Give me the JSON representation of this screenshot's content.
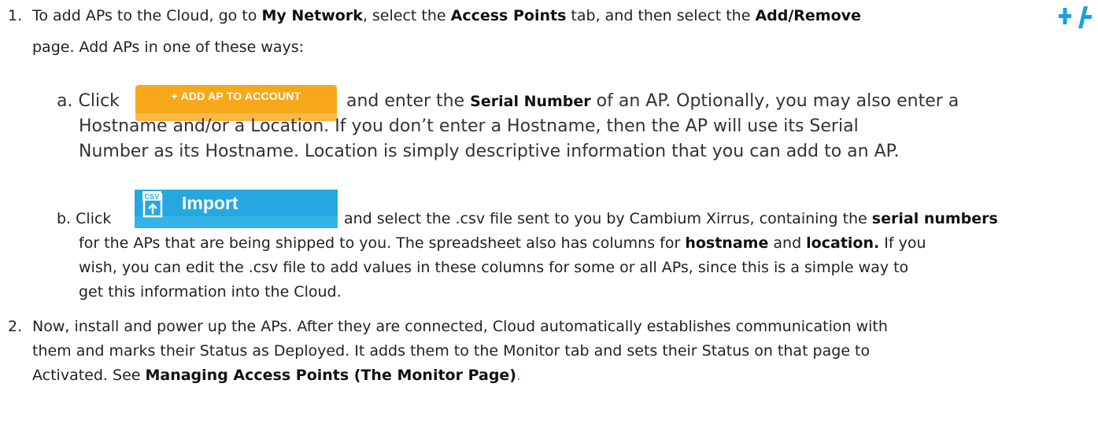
{
  "step1": {
    "number": "1.",
    "pre": "To add APs to the Cloud, go to ",
    "my_network": "My Network",
    "mid1": ", select the ",
    "access_points": "Access Points",
    "mid2": " tab, and then select the ",
    "add_remove": "Add/Remove",
    "icon_label": "+/-",
    "line2": "page. Add APs in one of these ways:"
  },
  "step_a": {
    "letter": "a.",
    "click": "Click",
    "button": "+ ADD AP TO ACCOUNT",
    "post": "and enter the ",
    "serial_number": "Serial Number",
    "post2": " of an AP. Optionally, you may also enter a",
    "line2": "Hostname and/or a Location. If you don’t enter a Hostname, then the AP will use its Serial",
    "line3": "Number as its Hostname. Location is simply descriptive information that you can add to an AP."
  },
  "step_b": {
    "letter": "b.",
    "click": "Click",
    "button": "Import",
    "icon_tag": "CSV",
    "post": "and select the .csv file sent to you by Cambium Xirrus, containing the ",
    "serial_numbers": "serial numbers",
    "line2_pre": "for the APs that are being shipped to you. The spreadsheet also has columns for ",
    "hostname": "hostname",
    "and": " and ",
    "location": "location.",
    "line2_post": " If you",
    "line3": "wish, you can edit the .csv file to add values in these columns for some or all APs, since this is a simple way to",
    "line4": "get this information into the Cloud."
  },
  "step2": {
    "number": "2.",
    "line1": "Now, install and power up the APs. After they are connected, Cloud automatically establishes communication with",
    "line2": "them and marks their Status as Deployed. It adds them to the Monitor tab and sets their Status on that page to",
    "line3_pre": "Activated. See ",
    "link": "Managing Access Points (The Monitor Page)",
    "line3_post": "."
  },
  "colors": {
    "add_button": "#f7a81a",
    "import_button": "#26a7df",
    "plus_minus_icon": "#1e9fe0"
  }
}
